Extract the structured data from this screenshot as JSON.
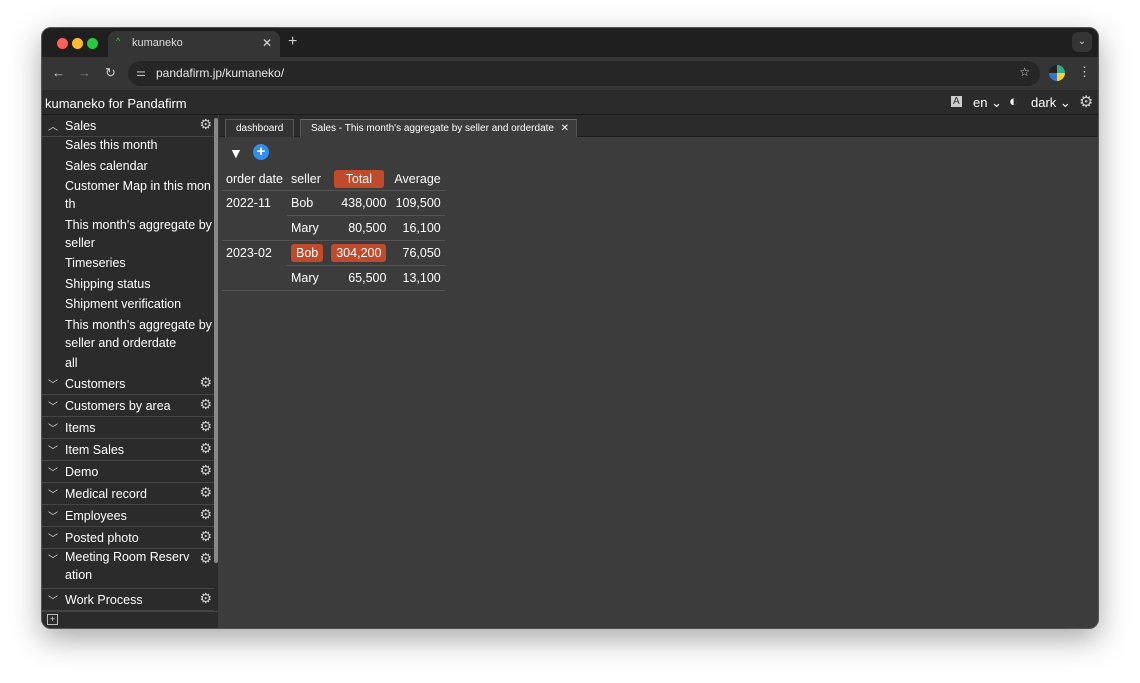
{
  "browser": {
    "tab_title": "kumaneko",
    "url": "pandafirm.jp/kumaneko/"
  },
  "app": {
    "title": "kumaneko for Pandafirm",
    "language": "en",
    "theme": "dark"
  },
  "sidebar": {
    "open_group": "Sales",
    "sub_items": [
      "Sales this month",
      "Sales calendar",
      "Customer Map in this month",
      "This month's aggregate by seller",
      "Timeseries",
      "Shipping status",
      "Shipment verification",
      "This month's aggregate by seller and orderdate",
      "all"
    ],
    "groups": [
      "Customers",
      "Customers by area",
      "Items",
      "Item Sales",
      "Demo",
      "Medical record",
      "Employees",
      "Posted photo",
      "Meeting Room Reservation",
      "Work Process"
    ]
  },
  "tabs": [
    "dashboard",
    "Sales - This month's aggregate by seller and orderdate"
  ],
  "table": {
    "headers": [
      "order date",
      "seller",
      "Total",
      "Average"
    ],
    "rows": [
      {
        "date": "2022-11",
        "seller": "Bob",
        "total": "438,000",
        "avg": "109,500"
      },
      {
        "date": "",
        "seller": "Mary",
        "total": "80,500",
        "avg": "16,100"
      },
      {
        "date": "2023-02",
        "seller": "Bob",
        "total": "304,200",
        "avg": "76,050"
      },
      {
        "date": "",
        "seller": "Mary",
        "total": "65,500",
        "avg": "13,100"
      }
    ]
  },
  "colors": {
    "accent": "#c14a2b",
    "add": "#2f8ff0"
  }
}
